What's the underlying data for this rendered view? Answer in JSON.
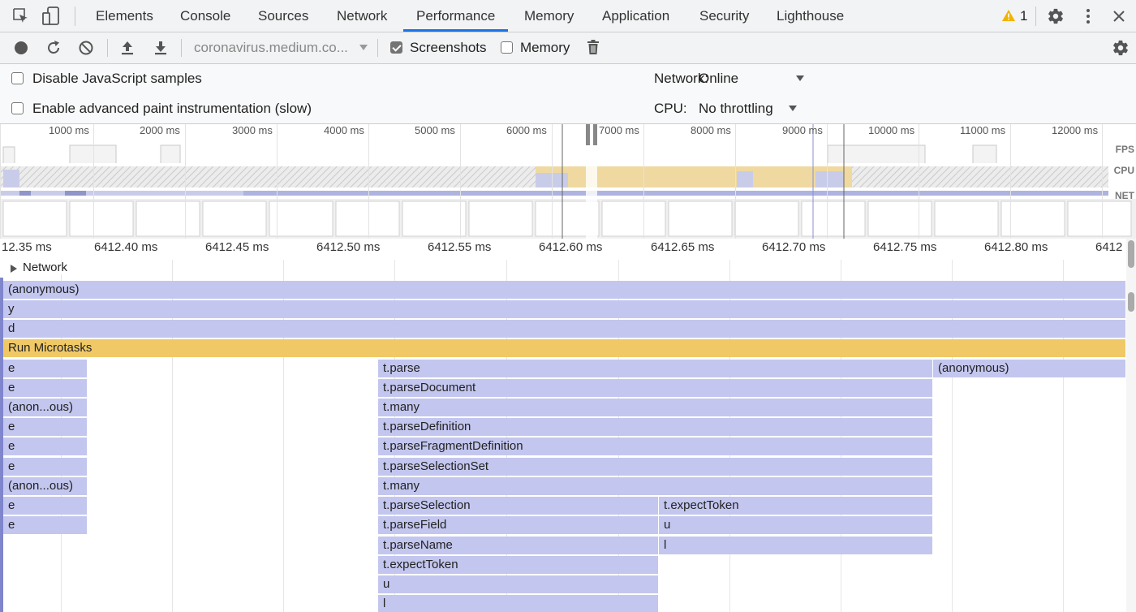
{
  "tabs": [
    {
      "label": "Elements",
      "active": false
    },
    {
      "label": "Console",
      "active": false
    },
    {
      "label": "Sources",
      "active": false
    },
    {
      "label": "Network",
      "active": false
    },
    {
      "label": "Performance",
      "active": true
    },
    {
      "label": "Memory",
      "active": false
    },
    {
      "label": "Application",
      "active": false
    },
    {
      "label": "Security",
      "active": false
    },
    {
      "label": "Lighthouse",
      "active": false
    }
  ],
  "warnings": {
    "count": "1"
  },
  "toolbar": {
    "profile_select": "coronavirus.medium.co...",
    "screenshots_label": "Screenshots",
    "screenshots_checked": true,
    "memory_label": "Memory",
    "memory_checked": false
  },
  "settings": {
    "disable_js_samples": "Disable JavaScript samples",
    "enable_paint": "Enable advanced paint instrumentation (slow)",
    "network_label": "Network:",
    "network_value": "Online",
    "cpu_label": "CPU:",
    "cpu_value": "No throttling"
  },
  "overview": {
    "ticks": [
      "1000 ms",
      "2000 ms",
      "3000 ms",
      "4000 ms",
      "5000 ms",
      "6000 ms",
      "7000 ms",
      "8000 ms",
      "9000 ms",
      "10000 ms",
      "11000 ms",
      "12000 ms"
    ],
    "tracks": {
      "fps": "FPS",
      "cpu": "CPU",
      "net": "NET"
    }
  },
  "ruler": {
    "ticks": [
      "12.35 ms",
      "6412.40 ms",
      "6412.45 ms",
      "6412.50 ms",
      "6412.55 ms",
      "6412.60 ms",
      "6412.65 ms",
      "6412.70 ms",
      "6412.75 ms",
      "6412.80 ms",
      "6412"
    ]
  },
  "network_section": "Network",
  "flame": [
    {
      "name": "(anonymous)",
      "type": "js"
    },
    {
      "name": "y",
      "type": "js"
    },
    {
      "name": "d",
      "type": "js"
    },
    {
      "name": "Run Microtasks",
      "type": "microtask"
    },
    {
      "name": "e",
      "type": "js"
    },
    {
      "name": "t.parse",
      "type": "js"
    },
    {
      "name": "(anonymous)",
      "type": "js"
    },
    {
      "name": "e",
      "type": "js"
    },
    {
      "name": "t.parseDocument",
      "type": "js"
    },
    {
      "name": "(anon...ous)",
      "type": "js"
    },
    {
      "name": "t.many",
      "type": "js"
    },
    {
      "name": "e",
      "type": "js"
    },
    {
      "name": "t.parseDefinition",
      "type": "js"
    },
    {
      "name": "e",
      "type": "js"
    },
    {
      "name": "t.parseFragmentDefinition",
      "type": "js"
    },
    {
      "name": "e",
      "type": "js"
    },
    {
      "name": "t.parseSelectionSet",
      "type": "js"
    },
    {
      "name": "(anon...ous)",
      "type": "js"
    },
    {
      "name": "t.many",
      "type": "js"
    },
    {
      "name": "e",
      "type": "js"
    },
    {
      "name": "t.parseSelection",
      "type": "js"
    },
    {
      "name": "t.expectToken",
      "type": "js"
    },
    {
      "name": "e",
      "type": "js"
    },
    {
      "name": "t.parseField",
      "type": "js"
    },
    {
      "name": "u",
      "type": "js"
    },
    {
      "name": "t.parseName",
      "type": "js"
    },
    {
      "name": "l",
      "type": "js"
    },
    {
      "name": "t.expectToken",
      "type": "js"
    },
    {
      "name": "u",
      "type": "js"
    },
    {
      "name": "l",
      "type": "js"
    }
  ],
  "colors": {
    "js": "#c3c6ee",
    "microtask": "#f0c966",
    "accent": "#1a73e8"
  }
}
